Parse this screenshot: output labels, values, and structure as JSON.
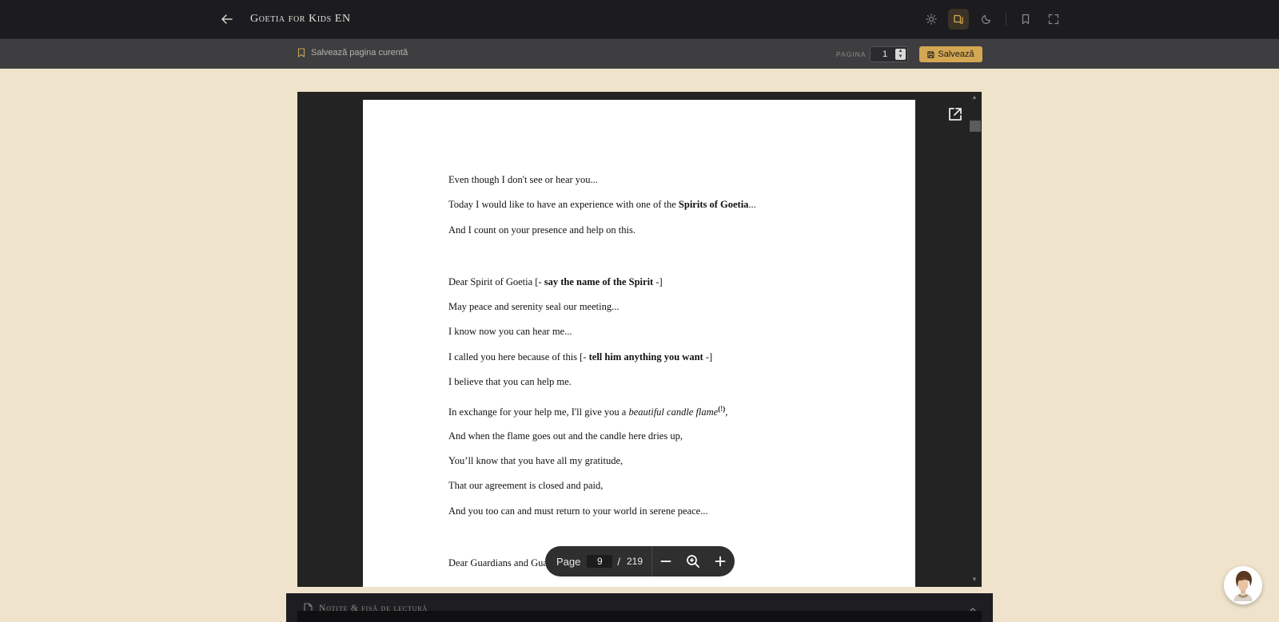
{
  "header": {
    "title": "Goetia for Kids EN",
    "icons": [
      "arrow-left-icon",
      "sun-icon",
      "book-open-icon",
      "moon-icon",
      "bookmark-icon",
      "fullscreen-icon"
    ]
  },
  "subbar": {
    "save_current_label": "Salvează pagina curentă",
    "page_label": "PAGINA",
    "page_value": "1",
    "save_button_label": "Salvează"
  },
  "document": {
    "lines": {
      "l1": "Even though I don't see or hear you...",
      "l2a": "Today I would like to have an experience with one of the ",
      "l2b": "Spirits of Goetia",
      "l2c": "...",
      "l3": "And I count on your presence and help on this.",
      "l4a": "Dear Spirit of Goetia [- ",
      "l4b": "say the name of the Spirit",
      "l4c": " -]",
      "l5": "May peace and serenity seal our meeting...",
      "l6": "I know now you can hear me...",
      "l7a": "I called you here because of this [- ",
      "l7b": "tell him anything you want",
      "l7c": " -]",
      "l8": "I believe that you can help me.",
      "l9a": "In exchange for your help me, I'll give you a ",
      "l9b": "beautiful candle flame",
      "l9c": "(!)",
      "l9d": ",",
      "l10": "And when the flame goes out and the candle here dries up,",
      "l11": "You’ll know that you have all my gratitude,",
      "l12": "That our agreement is closed and paid,",
      "l13": "And you too can and must return to your world in serene peace...",
      "l14": "Dear Guardians and Guardians..."
    }
  },
  "pdf_toolbar": {
    "page_label": "Page",
    "current_page": "9",
    "separator": "/",
    "total_pages": "219"
  },
  "notes_panel": {
    "label": "Notițe & fișă de lectură"
  },
  "colors": {
    "background": "#efe3cb",
    "topbar": "#1b1b20",
    "subbar": "#3e3e40",
    "accent": "#d4a752",
    "viewer": "#232323"
  }
}
